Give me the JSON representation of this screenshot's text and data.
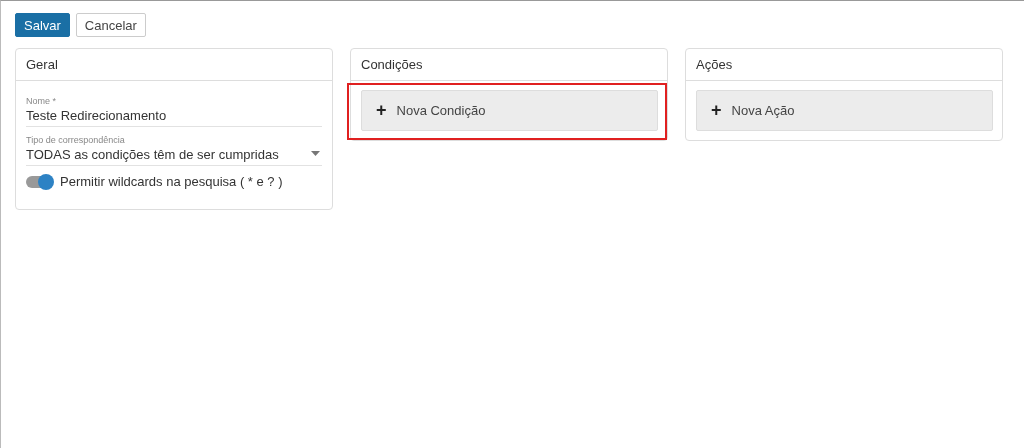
{
  "toolbar": {
    "buttons": [
      {
        "label": "Salvar",
        "kind": "primary"
      },
      {
        "label": "Cancelar",
        "kind": "secondary"
      }
    ]
  },
  "panels": [
    {
      "title": "Geral",
      "kind": "form",
      "fields": [
        {
          "kind": "text",
          "label": "Nome *",
          "value": "Teste Redirecionamento"
        },
        {
          "kind": "select",
          "label": "Tipo de correspondência",
          "value": "TODAS as condições têm de ser cumpridas"
        },
        {
          "kind": "toggle",
          "label": "Permitir wildcards na pesquisa ( * e ? )",
          "on": true
        }
      ]
    },
    {
      "title": "Condições",
      "kind": "add",
      "add_button": {
        "icon": "+",
        "label": "Nova Condição",
        "highlighted": true
      }
    },
    {
      "title": "Ações",
      "kind": "add",
      "add_button": {
        "icon": "+",
        "label": "Nova Ação",
        "highlighted": false
      }
    }
  ]
}
